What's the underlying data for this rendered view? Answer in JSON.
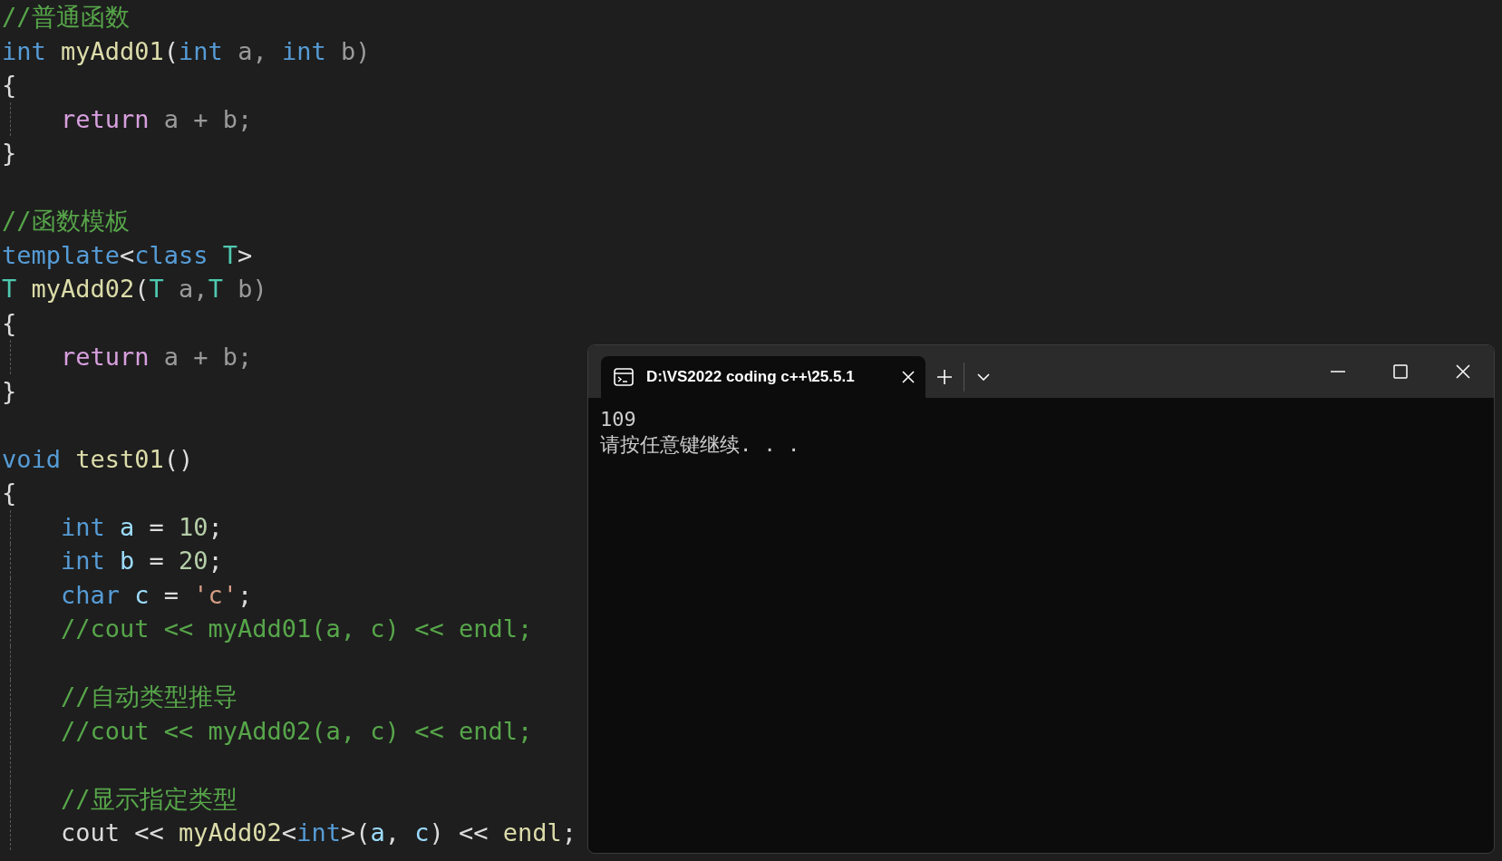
{
  "editor": {
    "lines": [
      {
        "indented": false,
        "tokens": [
          {
            "text": "//普通函数",
            "kind": "comment"
          }
        ]
      },
      {
        "indented": false,
        "tokens": [
          {
            "text": "int",
            "kind": "keyword"
          },
          {
            "text": " myAdd01",
            "kind": "function"
          },
          {
            "text": "(",
            "kind": "plain"
          },
          {
            "text": "int",
            "kind": "keyword"
          },
          {
            "text": " a, ",
            "kind": "param"
          },
          {
            "text": "int",
            "kind": "keyword"
          },
          {
            "text": " b)",
            "kind": "param"
          }
        ]
      },
      {
        "indented": false,
        "tokens": [
          {
            "text": "{",
            "kind": "plain"
          }
        ]
      },
      {
        "indented": true,
        "tokens": [
          {
            "text": "return",
            "kind": "control"
          },
          {
            "text": " a + b;",
            "kind": "param"
          }
        ]
      },
      {
        "indented": false,
        "tokens": [
          {
            "text": "}",
            "kind": "plain"
          }
        ]
      },
      {
        "indented": false
      },
      {
        "indented": false,
        "tokens": [
          {
            "text": "//函数模板",
            "kind": "comment"
          }
        ]
      },
      {
        "indented": false,
        "tokens": [
          {
            "text": "template",
            "kind": "keyword"
          },
          {
            "text": "<",
            "kind": "plain"
          },
          {
            "text": "class",
            "kind": "keyword"
          },
          {
            "text": " T",
            "kind": "type"
          },
          {
            "text": ">",
            "kind": "plain"
          }
        ]
      },
      {
        "indented": false,
        "tokens": [
          {
            "text": "T",
            "kind": "type"
          },
          {
            "text": " myAdd02",
            "kind": "function"
          },
          {
            "text": "(",
            "kind": "plain"
          },
          {
            "text": "T",
            "kind": "type"
          },
          {
            "text": " a,",
            "kind": "param"
          },
          {
            "text": "T",
            "kind": "type"
          },
          {
            "text": " b)",
            "kind": "param"
          }
        ]
      },
      {
        "indented": false,
        "tokens": [
          {
            "text": "{",
            "kind": "plain"
          }
        ]
      },
      {
        "indented": true,
        "tokens": [
          {
            "text": "return",
            "kind": "control"
          },
          {
            "text": " a + b;",
            "kind": "param"
          }
        ]
      },
      {
        "indented": false,
        "tokens": [
          {
            "text": "}",
            "kind": "plain"
          }
        ]
      },
      {
        "indented": false
      },
      {
        "indented": false,
        "tokens": [
          {
            "text": "void",
            "kind": "keyword"
          },
          {
            "text": " test01",
            "kind": "function"
          },
          {
            "text": "()",
            "kind": "plain"
          }
        ]
      },
      {
        "indented": false,
        "tokens": [
          {
            "text": "{",
            "kind": "plain"
          }
        ]
      },
      {
        "indented": true,
        "tokens": [
          {
            "text": "int",
            "kind": "keyword"
          },
          {
            "text": " a",
            "kind": "local"
          },
          {
            "text": " = ",
            "kind": "plain"
          },
          {
            "text": "10",
            "kind": "number"
          },
          {
            "text": ";",
            "kind": "plain"
          }
        ]
      },
      {
        "indented": true,
        "tokens": [
          {
            "text": "int",
            "kind": "keyword"
          },
          {
            "text": " b",
            "kind": "local"
          },
          {
            "text": " = ",
            "kind": "plain"
          },
          {
            "text": "20",
            "kind": "number"
          },
          {
            "text": ";",
            "kind": "plain"
          }
        ]
      },
      {
        "indented": true,
        "tokens": [
          {
            "text": "char",
            "kind": "keyword"
          },
          {
            "text": " c",
            "kind": "local"
          },
          {
            "text": " = ",
            "kind": "plain"
          },
          {
            "text": "'c'",
            "kind": "string"
          },
          {
            "text": ";",
            "kind": "plain"
          }
        ]
      },
      {
        "indented": true,
        "tokens": [
          {
            "text": "//cout << myAdd01(a, c) << endl;",
            "kind": "comment"
          }
        ]
      },
      {
        "indented": true
      },
      {
        "indented": true,
        "tokens": [
          {
            "text": "//自动类型推导",
            "kind": "comment"
          }
        ]
      },
      {
        "indented": true,
        "tokens": [
          {
            "text": "//cout << myAdd02(a, c) << endl;",
            "kind": "comment"
          }
        ]
      },
      {
        "indented": true
      },
      {
        "indented": true,
        "tokens": [
          {
            "text": "//显示指定类型",
            "kind": "comment"
          }
        ]
      },
      {
        "indented": true,
        "tokens": [
          {
            "text": "cout",
            "kind": "plain"
          },
          {
            "text": " << ",
            "kind": "plain"
          },
          {
            "text": "myAdd02",
            "kind": "function"
          },
          {
            "text": "<",
            "kind": "plain"
          },
          {
            "text": "int",
            "kind": "keyword"
          },
          {
            "text": ">(",
            "kind": "plain"
          },
          {
            "text": "a",
            "kind": "local"
          },
          {
            "text": ", ",
            "kind": "plain"
          },
          {
            "text": "c",
            "kind": "local"
          },
          {
            "text": ") << ",
            "kind": "plain"
          },
          {
            "text": "endl",
            "kind": "function"
          },
          {
            "text": ";",
            "kind": "plain"
          }
        ]
      }
    ]
  },
  "terminal": {
    "tab": {
      "title": "D:\\VS2022 coding c++\\25.5.1",
      "selected": true
    },
    "output": [
      "109",
      "请按任意键继续. . ."
    ]
  }
}
